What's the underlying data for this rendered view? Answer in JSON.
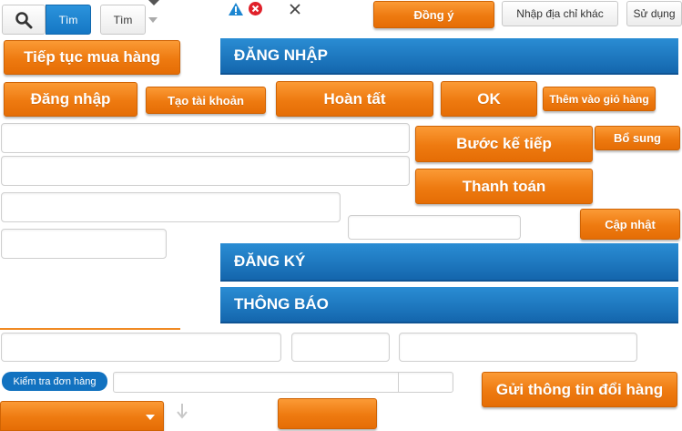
{
  "search_bar": {
    "search_button_label": "Tìm",
    "secondary_button_label": "Tìm"
  },
  "toolbar": {
    "agree": "Đồng ý",
    "enter_other_address": "Nhập địa chỉ khác",
    "use": "Sử dụng"
  },
  "buttons": {
    "continue_shopping": "Tiếp tục mua hàng",
    "login": "Đăng nhập",
    "create_account": "Tạo tài khoản",
    "complete": "Hoàn tất",
    "ok": "OK",
    "add_to_cart": "Thêm vào giỏ hàng",
    "next_step": "Bước kế tiếp",
    "supplement": "Bổ sung",
    "checkout": "Thanh toán",
    "update": "Cập nhật",
    "send_exchange_info": "Gửi thông tin đổi hàng",
    "check_order": "Kiểm tra đơn hàng"
  },
  "sections": {
    "login": "ĐĂNG NHẬP",
    "register": "ĐĂNG KÝ",
    "notification": "THÔNG BÁO"
  },
  "colors": {
    "orange_button": "#ee7a10",
    "blue_header": "#1a76bf",
    "check_order_pill": "#1272c0"
  },
  "icons": [
    "search-icon",
    "warning-icon",
    "error-icon",
    "close-icon",
    "dropdown-arrow-icon",
    "arrow-down-icon"
  ]
}
